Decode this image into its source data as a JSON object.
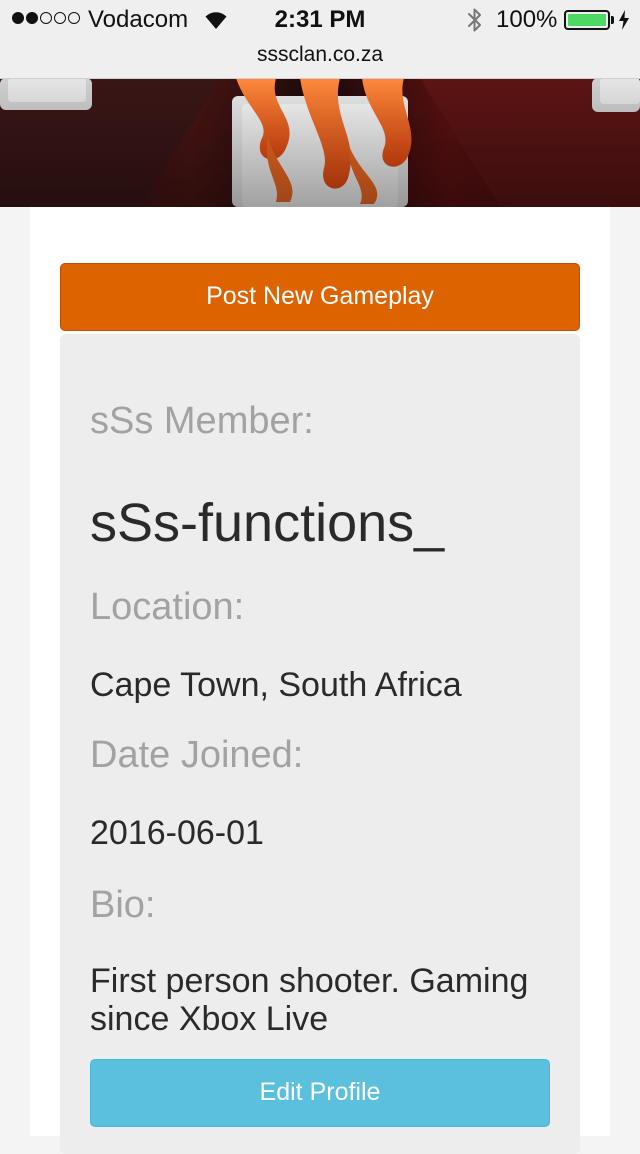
{
  "status_bar": {
    "carrier": "Vodacom",
    "time": "2:31 PM",
    "battery": "100%",
    "signal_bars_filled": 2,
    "signal_bars_total": 5,
    "battery_level": 1.0,
    "battery_color": "#4cd964"
  },
  "browser": {
    "url": "sssclan.co.za"
  },
  "actions": {
    "post_gameplay": "Post New Gameplay",
    "edit_profile": "Edit Profile",
    "post_color": "#dd6200",
    "edit_color": "#5bc0de"
  },
  "profile": {
    "member_label": "sSs Member:",
    "member_name": "sSs-functions_",
    "location_label": "Location:",
    "location": "Cape Town, South Africa",
    "joined_label": "Date Joined:",
    "joined": "2016-06-01",
    "bio_label": "Bio:",
    "bio": "First person shooter. Gaming since Xbox Live"
  }
}
